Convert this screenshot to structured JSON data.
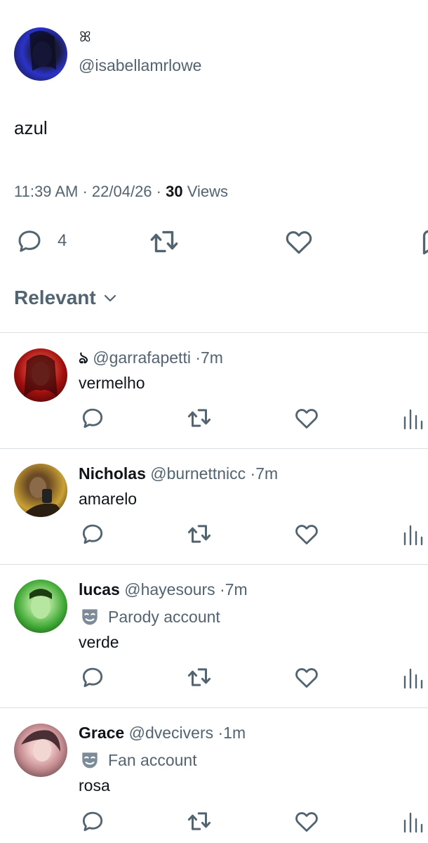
{
  "post": {
    "display_name": "ꕤ",
    "handle": "@isabellamrlowe",
    "text": "azul",
    "time": "11:39 AM",
    "date": "22/04/26",
    "views_count": "30",
    "views_label": "Views",
    "reply_count": "4"
  },
  "sort": {
    "label": "Relevant"
  },
  "replies": [
    {
      "name": "ঌ",
      "handle": "@garrafapetti",
      "time": "7m",
      "text": "vermelho",
      "badge": ""
    },
    {
      "name": "Nicholas",
      "handle": "@burnettnicc",
      "time": "7m",
      "text": "amarelo",
      "badge": ""
    },
    {
      "name": "lucas",
      "handle": "@hayesours",
      "time": "7m",
      "text": "verde",
      "badge": "Parody account"
    },
    {
      "name": "Grace",
      "handle": "@dvecivers",
      "time": "1m",
      "text": "rosa",
      "badge": "Fan account"
    }
  ],
  "colors": {
    "text": "#0f1419",
    "muted": "#536471",
    "divider": "#dcdfe2"
  },
  "icons": [
    "reply-icon",
    "repost-icon",
    "like-icon",
    "bookmark-icon",
    "views-icon",
    "chevron-down-icon",
    "mask-icon"
  ]
}
